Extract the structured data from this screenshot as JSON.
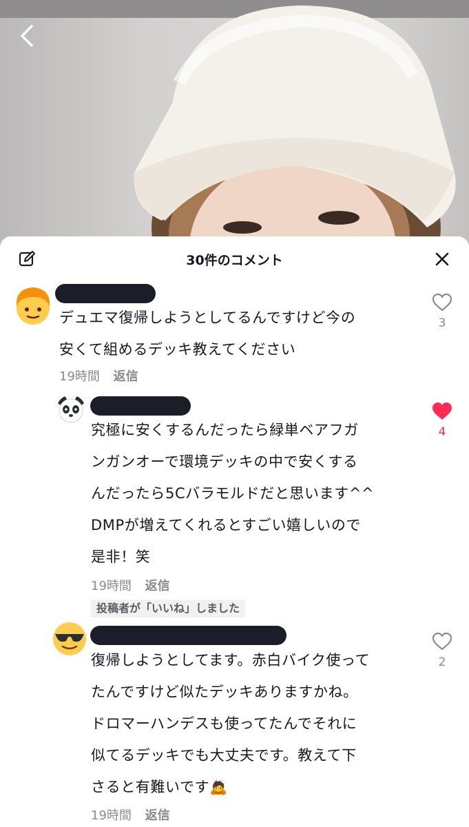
{
  "header": {
    "title": "30件のコメント"
  },
  "comments": [
    {
      "text": "デュエマ復帰しようとしてるんですけど今の\n安くて組めるデッキ教えてください",
      "time": "19時間",
      "reply_label": "返信",
      "likes": "3",
      "liked": false,
      "avatar_icon": "person-emoji-icon"
    },
    {
      "text": "究極に安くするんだったら緑単ベアフガ\nンガンオーで環境デッキの中で安くする\nんだったら5Cバラモルドだと思います^^\nDMPが増えてくれるとすごい嬉しいので\n是非！笑",
      "time": "19時間",
      "reply_label": "返信",
      "likes": "4",
      "liked": true,
      "avatar_icon": "panda-emoji-icon",
      "creator_badge": "投稿者が「いいね」しました"
    },
    {
      "text": "復帰しようとしてます。赤白バイク使って\nたんですけど似たデッキありますかね。\nドロマーハンデスも使ってたんでそれに\n似てるデッキでも大丈夫です。教えて下\nさると有難いです🙇",
      "time": "19時間",
      "reply_label": "返信",
      "likes": "2",
      "liked": false,
      "avatar_icon": "sunglasses-emoji-icon"
    }
  ],
  "colors": {
    "like_active": "#fe2c55",
    "meta_text": "#8a8b91",
    "primary_text": "#161823"
  }
}
